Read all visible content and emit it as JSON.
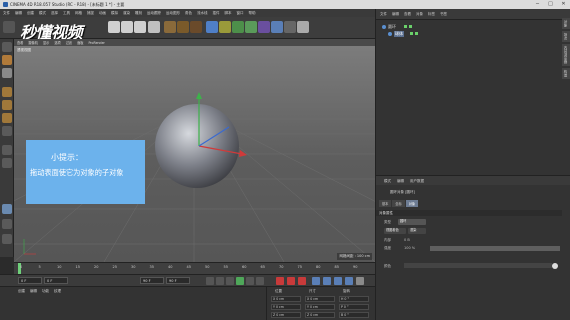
{
  "window": {
    "title": "CINEMA 4D R18.057 Studio (RC - R18) - [未标题 1 *] - 主要"
  },
  "watermark": {
    "text": "秒懂视频"
  },
  "menubar": [
    "文件",
    "编辑",
    "创建",
    "模式",
    "选择",
    "工具",
    "网格",
    "捕捉",
    "动画",
    "模拟",
    "渲染",
    "雕刻",
    "运动跟踪",
    "运动图形",
    "角色",
    "流水线",
    "插件",
    "脚本",
    "窗口",
    "帮助"
  ],
  "objmgr": {
    "menu": [
      "文件",
      "编辑",
      "查看",
      "对象",
      "标签",
      "书签"
    ],
    "objects": [
      {
        "name": "圆环"
      },
      {
        "name": "球体"
      }
    ]
  },
  "viewport": {
    "menu": [
      "查看",
      "摄像机",
      "显示",
      "选项",
      "过滤",
      "面板",
      "ProRender"
    ],
    "view_label": "透视视图",
    "grid_distance": "网格间距 : 100 cm"
  },
  "tip": {
    "title": "小提示：",
    "text": "拖动表面使它为对象的子对象"
  },
  "timeline": {
    "ticks": [
      "0",
      "5",
      "10",
      "15",
      "20",
      "25",
      "30",
      "35",
      "40",
      "45",
      "50",
      "55",
      "60",
      "65",
      "70",
      "75",
      "80",
      "85",
      "90"
    ],
    "end_field": "0 F"
  },
  "transport": {
    "current": "0 F",
    "start": "0 F",
    "end": "90 F",
    "max": "90 F"
  },
  "material": {
    "menu": [
      "创建",
      "编辑",
      "功能",
      "纹理"
    ]
  },
  "coords": {
    "headers": [
      "位置",
      "尺寸",
      "旋转"
    ],
    "rows": [
      [
        "X 0 cm",
        "X 0 cm",
        "H 0 °"
      ],
      [
        "Y 0 cm",
        "Y 0 cm",
        "P 0 °"
      ],
      [
        "Z 0 cm",
        "Z 0 cm",
        "B 0 °"
      ]
    ]
  },
  "attr": {
    "menu": [
      "模式",
      "编辑",
      "用户数据"
    ],
    "title": "圆环对象 [圆环]",
    "tabs": [
      "基本",
      "坐标",
      "对象"
    ],
    "section": "对象属性",
    "type_label": "类型",
    "type_value": "圆环",
    "size_label": "内部",
    "size_value": "0 B",
    "ratio_label": "强度",
    "ratio_value": "100 %",
    "color_label": "颜色",
    "btns": [
      "视图着色",
      "渲染"
    ]
  },
  "right_tabs": [
    "对象",
    "场次",
    "内容浏览器",
    "构造"
  ]
}
